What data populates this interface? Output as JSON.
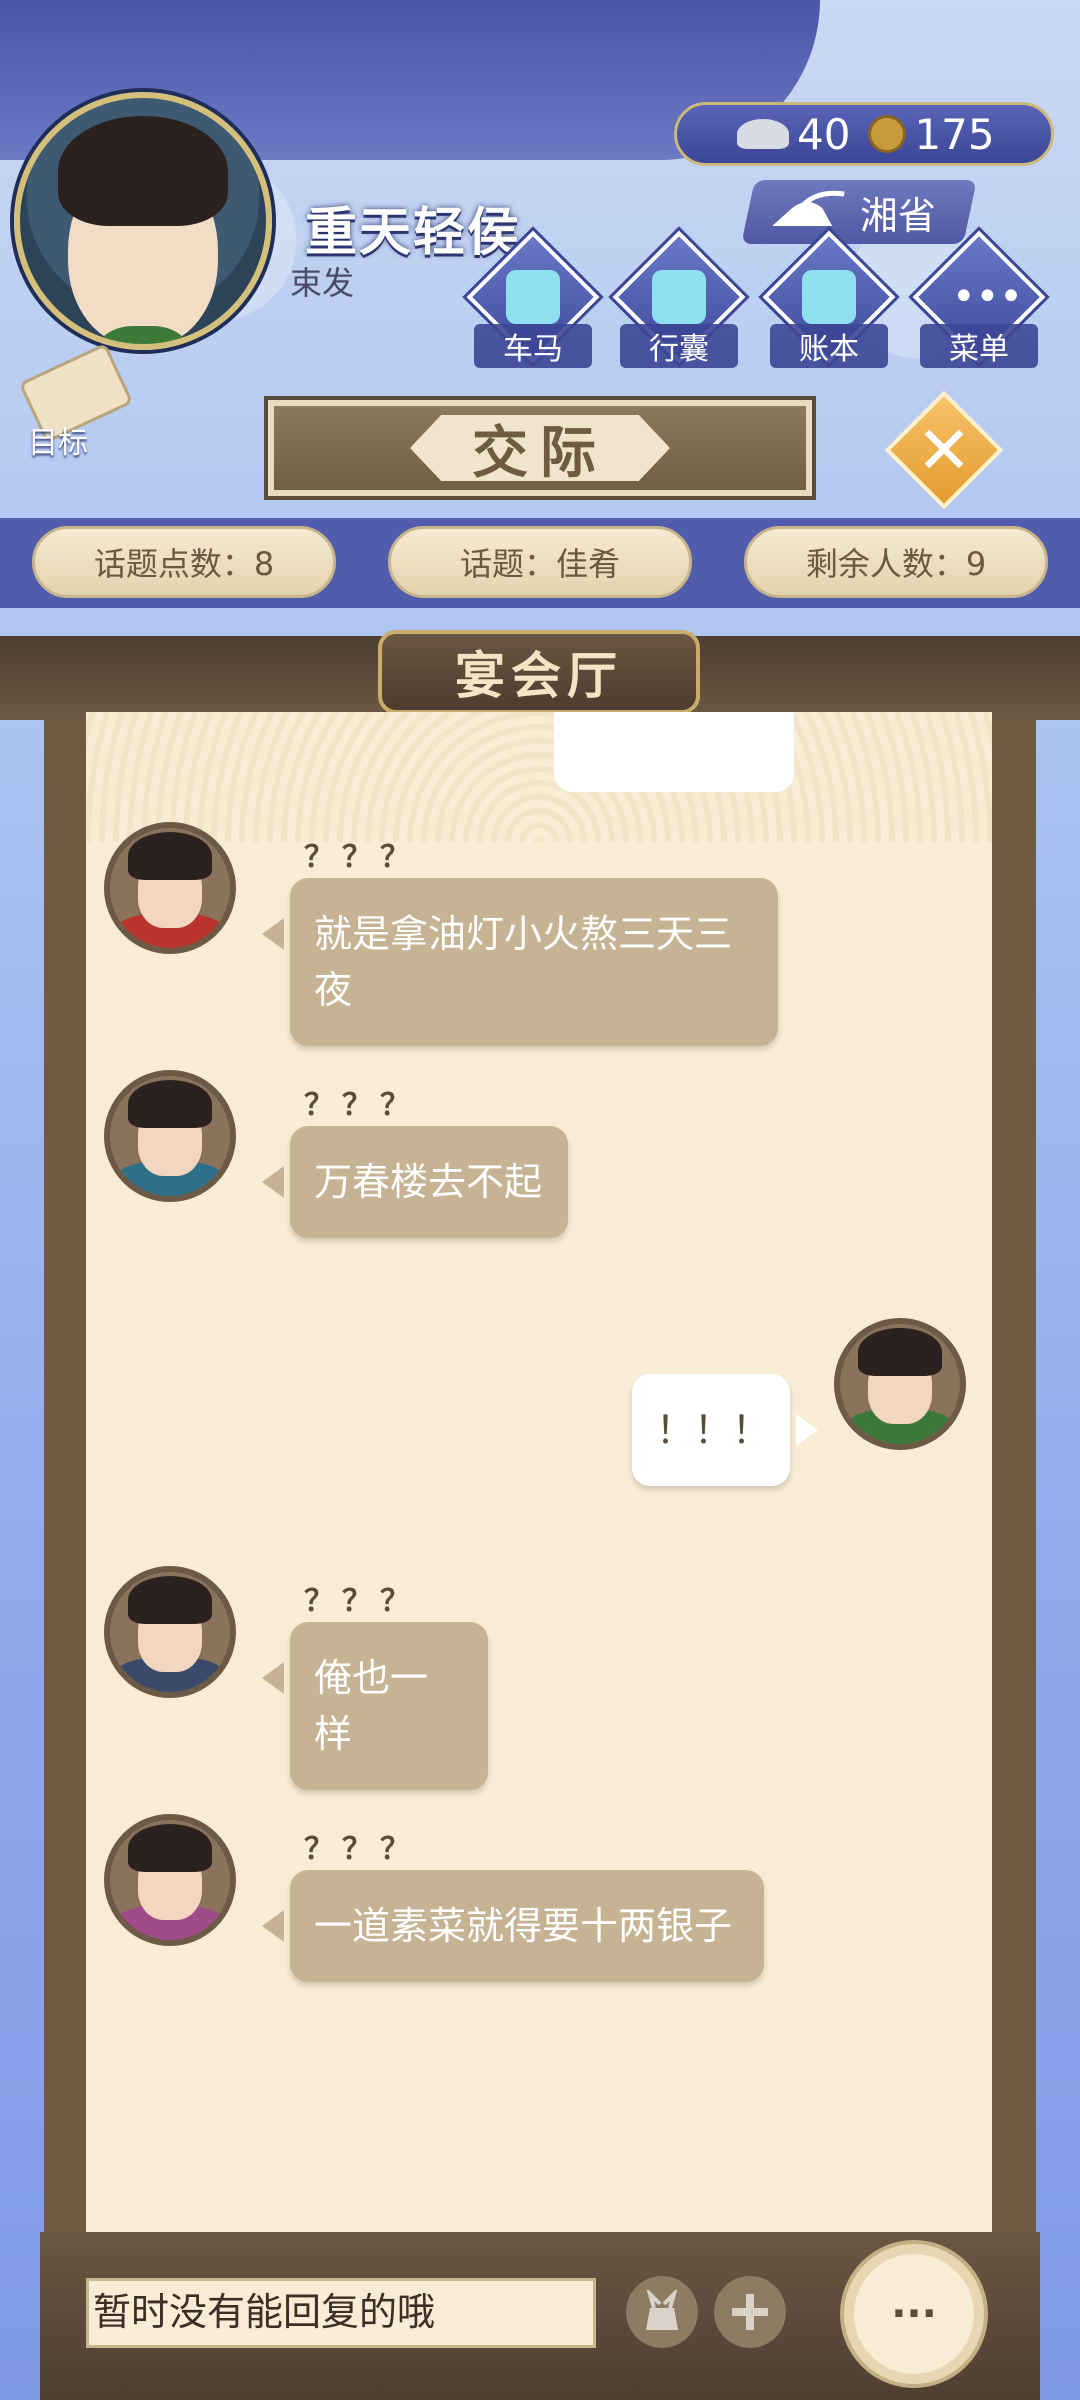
{
  "player": {
    "name": "重天轻侯",
    "hairstyle": "束发"
  },
  "currency": {
    "silver": "40",
    "coins": "175"
  },
  "province": "湘省",
  "nav": [
    {
      "label": "车马",
      "icon": "carriage-icon"
    },
    {
      "label": "行囊",
      "icon": "bag-icon"
    },
    {
      "label": "账本",
      "icon": "ledger-icon"
    },
    {
      "label": "菜单",
      "icon": "menu-dots-icon"
    }
  ],
  "goal_label": "目标",
  "screen_title": "交际",
  "stats": {
    "topic_points": "话题点数：8",
    "topic": "话题：佳肴",
    "remaining": "剩余人数：9"
  },
  "hall_name": "宴会厅",
  "messages": [
    {
      "sender": "？？？",
      "text": "就是拿油灯小火熬三天三夜",
      "mine": false
    },
    {
      "sender": "？？？",
      "text": "万春楼去不起",
      "mine": false
    },
    {
      "sender": "",
      "text": "！！！",
      "mine": true
    },
    {
      "sender": "？？？",
      "text": "俺也一样",
      "mine": false
    },
    {
      "sender": "？？？",
      "text": "一道素菜就得要十两银子",
      "mine": false
    }
  ],
  "input": {
    "placeholder": "暂时没有能回复的哦"
  },
  "more_label": "···",
  "colors": {
    "bubble_other": "#c6b393",
    "bubble_mine": "#ffffff",
    "panel_bg": "#f8ecd4",
    "accent_gold": "#e39b2e"
  }
}
